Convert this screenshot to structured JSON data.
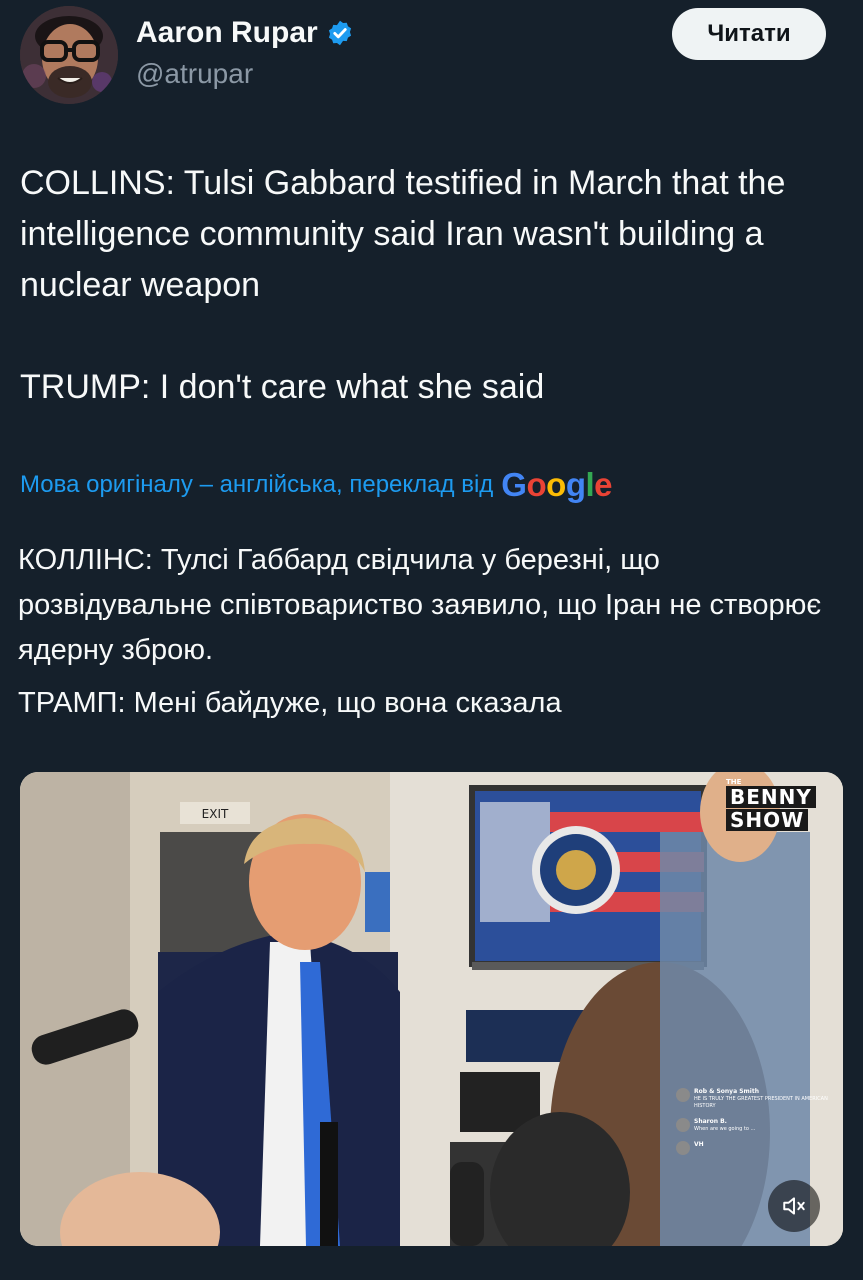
{
  "author": {
    "name": "Aaron Rupar",
    "handle": "@atrupar",
    "verified": true
  },
  "follow_button": {
    "label": "Читати"
  },
  "tweet": {
    "paragraphs": [
      "COLLINS: Tulsi Gabbard testified in March that the intelligence community said Iran wasn't building a nuclear weapon",
      "TRUMP: I don't care what she said"
    ]
  },
  "translation": {
    "note": "Мова оригіналу – англійська, переклад від",
    "provider_letters": [
      "G",
      "o",
      "o",
      "g",
      "l",
      "e"
    ],
    "paragraphs": [
      "КОЛЛІНС: Тулсі Габбард свідчила у березні, що розвідувальне співтовариство заявило, що Іран не створює ядерну зброю.",
      "ТРАМП: Мені байдуже, що вона сказала"
    ]
  },
  "video": {
    "watermark": {
      "small": "THE",
      "line1": "BENNY",
      "line2": "SHOW"
    },
    "sign_text": "EXIT",
    "chat": [
      {
        "name": "Rob & Sonya Smith",
        "text": "HE IS TRULY THE GREATEST PRESIDENT IN AMERICAN HISTORY"
      },
      {
        "name": "Sharon B.",
        "text": "When are we going to ..."
      },
      {
        "name": "VH",
        "text": ""
      }
    ],
    "mute_icon": "speaker-muted-icon"
  },
  "colors": {
    "background": "#15202b",
    "text": "#f7f9f9",
    "secondary_text": "#8b98a5",
    "link": "#1d9bf0",
    "verified": "#1d9bf0",
    "button_bg": "#eff3f4",
    "button_text": "#0f1419"
  }
}
